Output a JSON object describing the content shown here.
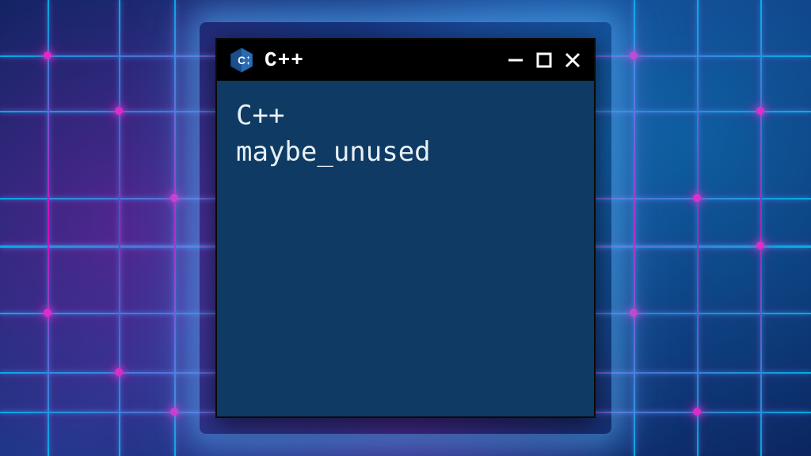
{
  "window": {
    "title": "C++",
    "icon_label": "C++"
  },
  "content": {
    "line1": "C++",
    "line2": "maybe_unused"
  },
  "colors": {
    "client_bg": "#0e3a63",
    "titlebar_bg": "#000000",
    "text": "#e8f0f6",
    "glow": "#5ab4ff"
  }
}
